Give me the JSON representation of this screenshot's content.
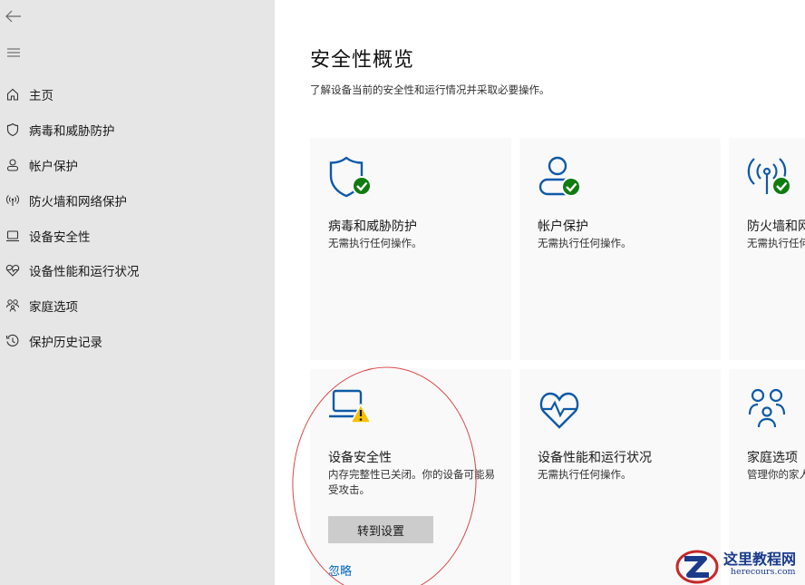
{
  "sidebar": {
    "nav_items": [
      {
        "label": "主页",
        "icon": "home-icon"
      },
      {
        "label": "病毒和威胁防护",
        "icon": "shield-icon"
      },
      {
        "label": "帐户保护",
        "icon": "person-icon"
      },
      {
        "label": "防火墙和网络保护",
        "icon": "antenna-icon"
      },
      {
        "label": "设备安全性",
        "icon": "laptop-icon"
      },
      {
        "label": "设备性能和运行状况",
        "icon": "heart-pulse-icon"
      },
      {
        "label": "家庭选项",
        "icon": "family-icon"
      },
      {
        "label": "保护历史记录",
        "icon": "history-icon"
      }
    ]
  },
  "main": {
    "title": "安全性概览",
    "subtitle": "了解设备当前的安全性和运行情况并采取必要操作。",
    "cards": [
      {
        "title": "病毒和威胁防护",
        "desc": "无需执行任何操作。",
        "status": "ok"
      },
      {
        "title": "帐户保护",
        "desc": "无需执行任何操作。",
        "status": "ok"
      },
      {
        "title": "防火墙和网络保护",
        "desc": "无需执行任何操作。",
        "status": "ok"
      },
      {
        "title": "设备安全性",
        "desc": "内存完整性已关闭。你的设备可能易受攻击。",
        "status": "warning",
        "button_label": "转到设置",
        "link_label": "忽略"
      },
      {
        "title": "设备性能和运行状况",
        "desc": "无需执行任何操作。"
      },
      {
        "title": "家庭选项",
        "desc": "管理你的家人使用设备的方式。"
      }
    ]
  },
  "watermark": {
    "text": "这里教程网",
    "url": "herecours.com"
  },
  "colors": {
    "sidebar_bg": "#e6e6e6",
    "card_bg": "#f9f9f9",
    "icon_blue": "#0e5aa7",
    "ok_green": "#107c10",
    "warning_yellow": "#f7c100",
    "link_blue": "#0067c0",
    "annotation_red": "#d94848"
  }
}
